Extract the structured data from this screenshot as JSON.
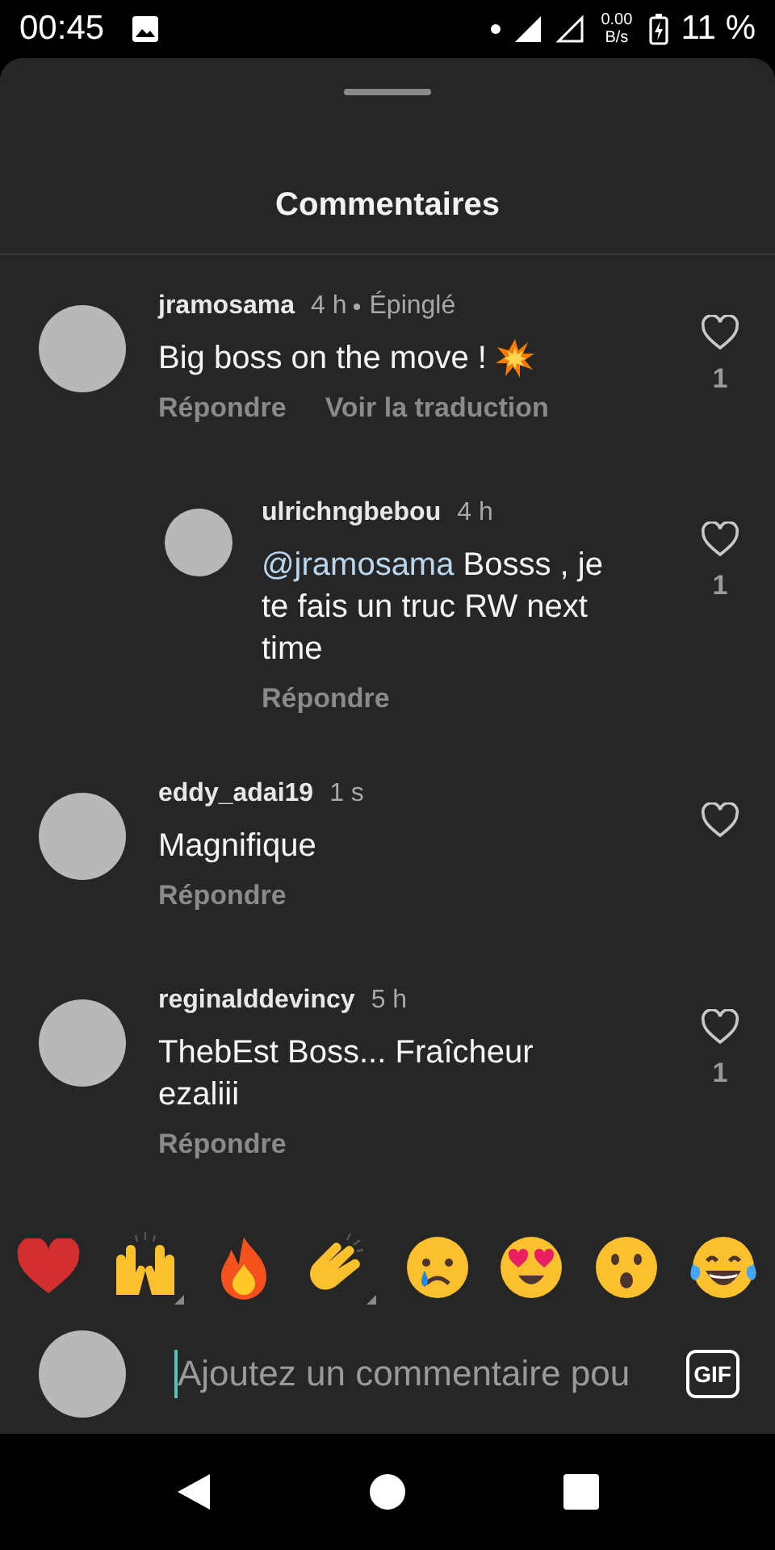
{
  "status_bar": {
    "time": "00:45",
    "net_speed_value": "0.00",
    "net_speed_unit": "B/s",
    "battery": "11 %"
  },
  "sheet": {
    "title": "Commentaires"
  },
  "comments": [
    {
      "username": "jramosama",
      "time": "4 h",
      "pinned_label": "Épinglé",
      "text": "Big boss on the move !",
      "has_burst": true,
      "reply": "Répondre",
      "translate": "Voir la traduction",
      "likes": "1",
      "replies": [
        {
          "username": "ulrichngbebou",
          "time": "4 h",
          "mention": "@jramosama",
          "text": "Bosss , je te fais un truc RW next time",
          "reply": "Répondre",
          "likes": "1"
        }
      ]
    },
    {
      "username": "eddy_adai19",
      "time": "1 s",
      "text": "Magnifique",
      "reply": "Répondre"
    },
    {
      "username": "reginalddevincy",
      "time": "5 h",
      "text": "ThebEst Boss... Fraîcheur ezaliii",
      "reply": "Répondre",
      "likes": "1"
    }
  ],
  "reactions": [
    {
      "kind": "heart"
    },
    {
      "kind": "raised-hands",
      "variants": true
    },
    {
      "kind": "fire"
    },
    {
      "kind": "clap",
      "variants": true
    },
    {
      "kind": "crying"
    },
    {
      "kind": "heart-eyes"
    },
    {
      "kind": "surprised"
    },
    {
      "kind": "laughing"
    }
  ],
  "composer": {
    "placeholder": "Ajoutez un commentaire pou",
    "gif_label": "GIF"
  }
}
